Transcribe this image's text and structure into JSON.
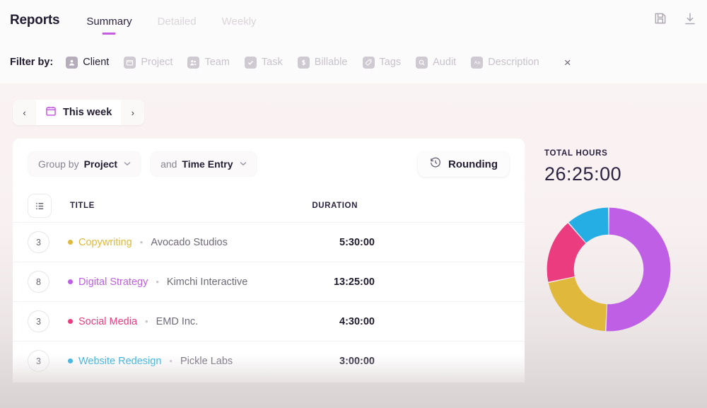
{
  "header": {
    "title": "Reports",
    "tabs": [
      {
        "label": "Summary",
        "active": true
      },
      {
        "label": "Detailed",
        "active": false
      },
      {
        "label": "Weekly",
        "active": false
      }
    ],
    "actions": [
      {
        "name": "save-icon",
        "label": "Save"
      },
      {
        "name": "download-icon",
        "label": "Download"
      }
    ]
  },
  "filter_bar": {
    "label": "Filter by:",
    "close_label": "×",
    "items": [
      {
        "label": "Client",
        "icon": "person-icon",
        "selected": true
      },
      {
        "label": "Project",
        "icon": "folder-icon",
        "selected": false
      },
      {
        "label": "Team",
        "icon": "team-icon",
        "selected": false
      },
      {
        "label": "Task",
        "icon": "checkbox-icon",
        "selected": false
      },
      {
        "label": "Billable",
        "icon": "dollar-icon",
        "selected": false
      },
      {
        "label": "Tags",
        "icon": "tag-icon",
        "selected": false
      },
      {
        "label": "Audit",
        "icon": "magnifier-icon",
        "selected": false
      },
      {
        "label": "Description",
        "icon": "text-aa-icon",
        "selected": false
      }
    ]
  },
  "date_nav": {
    "prev_label": "‹",
    "next_label": "›",
    "range_label": "This week",
    "calendar_icon": "calendar-icon"
  },
  "toolbar": {
    "group_by_prefix": "Group by",
    "group_by_value": "Project",
    "secondary_prefix": "and",
    "secondary_value": "Time Entry",
    "rounding_label": "Rounding",
    "rounding_icon": "clock-rewind-icon",
    "chevron": "⌄"
  },
  "table": {
    "list_icon": "list-view-icon",
    "columns": {
      "title": "TITLE",
      "duration": "DURATION"
    },
    "rows": [
      {
        "count": "3",
        "project": "Copywriting",
        "client": "Avocado Studios",
        "duration": "5:30:00",
        "color": "#e0b93c"
      },
      {
        "count": "8",
        "project": "Digital Strategy",
        "client": "Kimchi Interactive",
        "duration": "13:25:00",
        "color": "#bf5fe6"
      },
      {
        "count": "3",
        "project": "Social Media",
        "client": "EMD Inc.",
        "duration": "4:30:00",
        "color": "#ec3c80"
      },
      {
        "count": "3",
        "project": "Website Redesign",
        "client": "Pickle Labs",
        "duration": "3:00:00",
        "color": "#25aee4"
      }
    ],
    "separator": "•"
  },
  "totals": {
    "label": "TOTAL HOURS",
    "value": "26:25:00"
  },
  "chart_data": {
    "type": "pie",
    "title": "TOTAL HOURS",
    "donut": true,
    "total_label": "26:25:00",
    "total_hours": 26.4167,
    "categories": [
      "Digital Strategy",
      "Copywriting",
      "Social Media",
      "Website Redesign"
    ],
    "values": [
      13.4167,
      5.5,
      4.5,
      3.0
    ],
    "value_labels": [
      "13:25:00",
      "5:30:00",
      "4:30:00",
      "3:00:00"
    ],
    "colors": [
      "#bf5fe6",
      "#e0b93c",
      "#ec3c80",
      "#25aee4"
    ],
    "percentages": [
      50.8,
      20.8,
      17.0,
      11.4
    ],
    "start_angle": 0,
    "direction": "clockwise",
    "legend": "none"
  },
  "colors": {
    "accent": "#c65ce0",
    "background": "#faf2f2",
    "card": "#ffffff"
  }
}
